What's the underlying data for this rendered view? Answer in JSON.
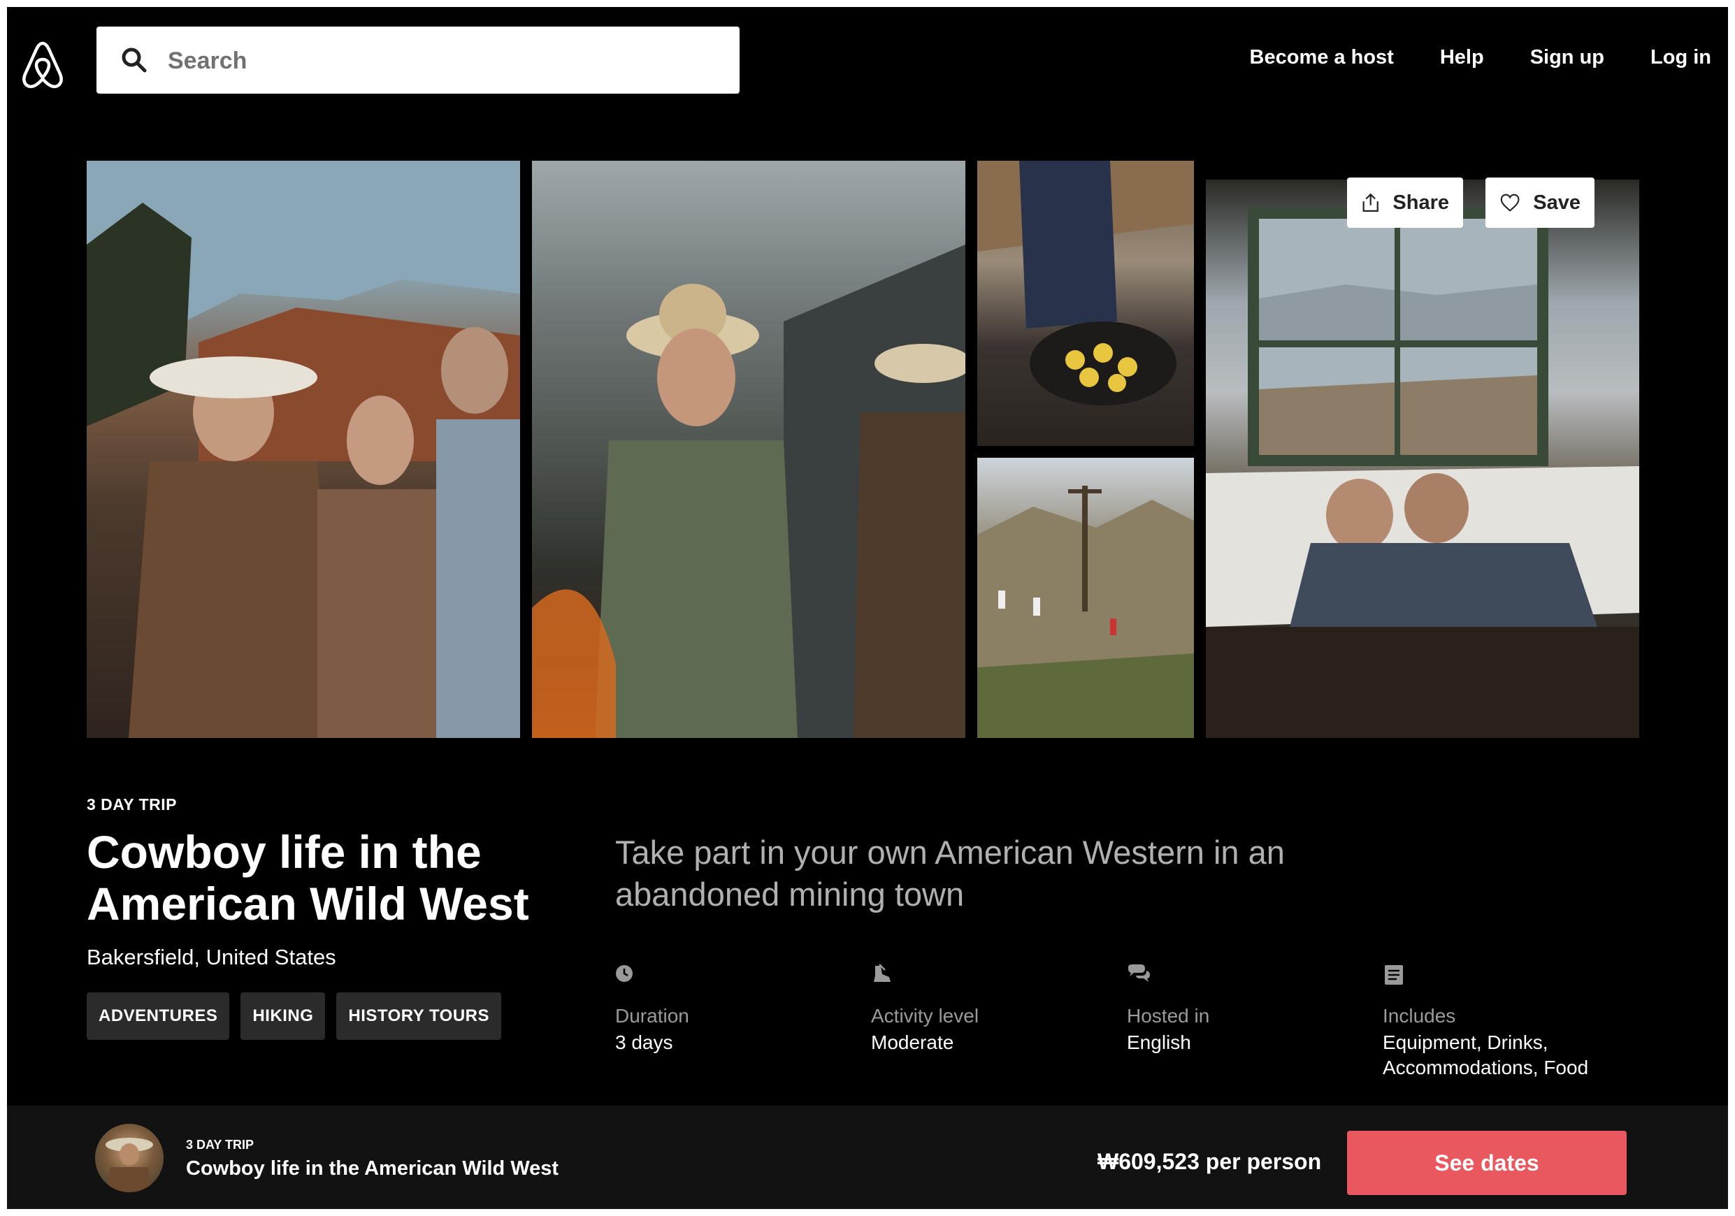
{
  "header": {
    "logo_icon": "airbnb-logo-icon",
    "search": {
      "placeholder": "Search",
      "value": ""
    },
    "nav": [
      "Become a host",
      "Help",
      "Sign up",
      "Log in"
    ]
  },
  "gallery": {
    "share_label": "Share",
    "save_label": "Save"
  },
  "listing": {
    "kicker": "3 DAY TRIP",
    "title": "Cowboy life in the American Wild West",
    "location": "Bakersfield, United States",
    "tags": [
      "ADVENTURES",
      "HIKING",
      "HISTORY TOURS"
    ],
    "tagline": "Take part in your own American Western in an abandoned mining town",
    "facts": [
      {
        "icon": "clock-icon",
        "label": "Duration",
        "value": "3 days"
      },
      {
        "icon": "hiking-boot-icon",
        "label": "Activity level",
        "value": "Moderate"
      },
      {
        "icon": "chat-bubbles-icon",
        "label": "Hosted in",
        "value": "English"
      },
      {
        "icon": "list-icon",
        "label": "Includes",
        "value": "Equipment, Drinks, Accommodations, Food"
      }
    ]
  },
  "bottom_bar": {
    "kicker": "3 DAY TRIP",
    "title": "Cowboy life in the American Wild West",
    "price": "₩609,523 per person",
    "cta_label": "See dates"
  },
  "colors": {
    "background": "#000000",
    "accent": "#e8585e",
    "tag_bg": "#2b2b2b",
    "bottom_bar_bg": "#121212"
  }
}
